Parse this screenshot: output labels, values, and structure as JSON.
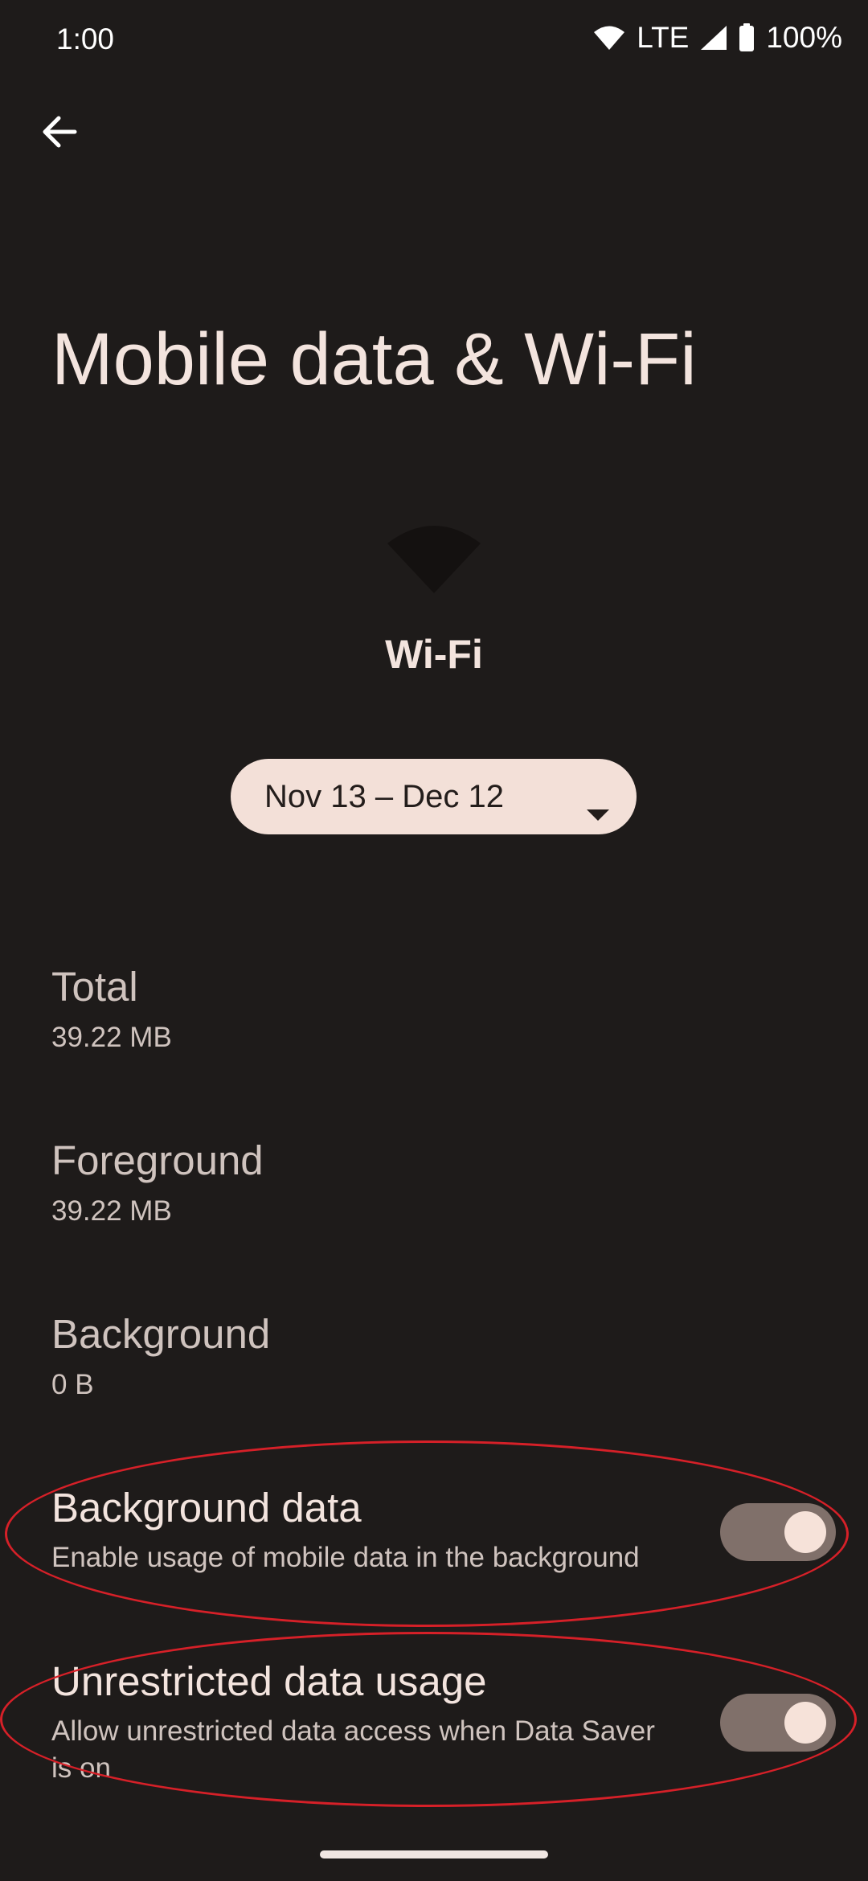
{
  "status_bar": {
    "time": "1:00",
    "network": "LTE",
    "battery": "100%",
    "icons": [
      "wifi-icon",
      "signal-icon",
      "battery-icon"
    ]
  },
  "header": {
    "back_icon": "arrow-back-icon",
    "title": "Mobile data & Wi-Fi"
  },
  "app": {
    "icon": "wifi-icon",
    "name": "Wi-Fi"
  },
  "cycle": {
    "label": "Nov 13 – Dec 12",
    "icon": "dropdown-caret-icon"
  },
  "stats": [
    {
      "label": "Total",
      "value": "39.22 MB"
    },
    {
      "label": "Foreground",
      "value": "39.22 MB"
    },
    {
      "label": "Background",
      "value": "0 B"
    }
  ],
  "toggles": [
    {
      "title": "Background data",
      "subtitle": "Enable usage of mobile data in the background",
      "on": true
    },
    {
      "title": "Unrestricted data usage",
      "subtitle": "Allow unrestricted data access when Data Saver is on",
      "on": true
    }
  ],
  "colors": {
    "background": "#1e1b1a",
    "text_primary": "#f3e4de",
    "text_secondary": "#cfc3be",
    "chip_background": "#f3e0d8",
    "toggle_track": "#80706a",
    "toggle_knob": "#f6e2d9",
    "annotation": "#d62028"
  }
}
